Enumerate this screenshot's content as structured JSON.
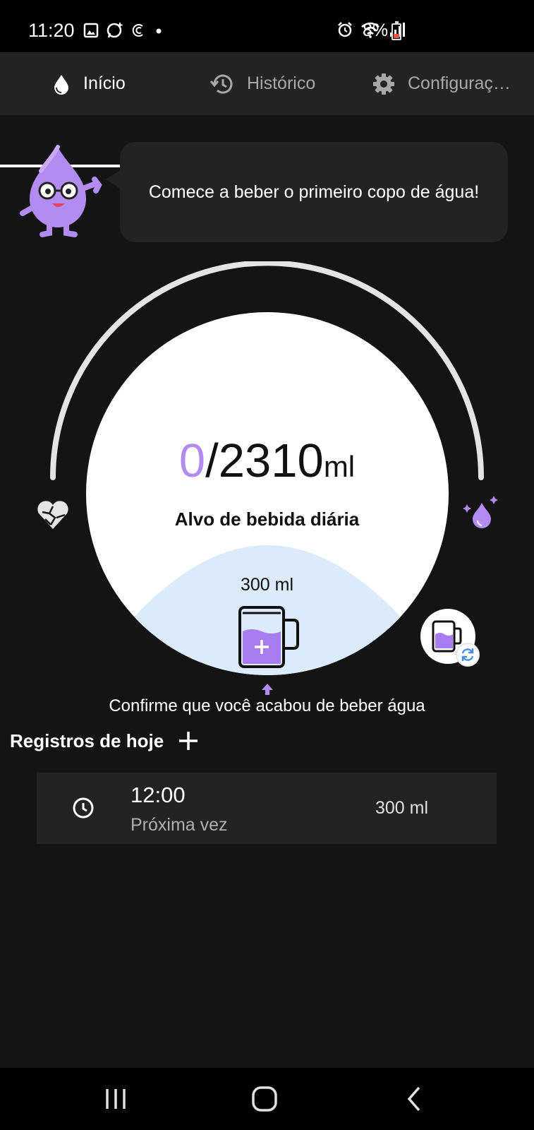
{
  "status_bar": {
    "time": "11:20",
    "battery": "8%",
    "battery_fill_fraction": 0.08,
    "left_icons": [
      "gallery-icon",
      "whatsapp-icon",
      "app-icon",
      "dot-icon"
    ],
    "right_icons": [
      "alarm-icon",
      "wifi-icon",
      "signal-icon"
    ]
  },
  "tabs": [
    {
      "label": "Início",
      "icon": "water-drop-icon",
      "active": true
    },
    {
      "label": "Histórico",
      "icon": "history-icon",
      "active": false
    },
    {
      "label": "Configuraç…",
      "icon": "gear-icon",
      "active": false
    }
  ],
  "bubble": {
    "message": "Comece a beber o primeiro copo de água!"
  },
  "gauge": {
    "current": "0",
    "separator": "/",
    "goal": "2310",
    "unit": "ml",
    "label": "Alvo de bebida diária",
    "cup_size": "300 ml",
    "progress_fraction": 0
  },
  "confirm_text": "Confirme que você acabou de beber água",
  "records": {
    "title": "Registros de hoje",
    "items": [
      {
        "time": "12:00",
        "subtitle": "Próxima vez",
        "amount": "300 ml"
      }
    ]
  },
  "colors": {
    "accent": "#b38cf2",
    "cup_fill": "#a67cf0",
    "wave": "#dcebfb",
    "background": "#141414",
    "card": "#232323"
  }
}
